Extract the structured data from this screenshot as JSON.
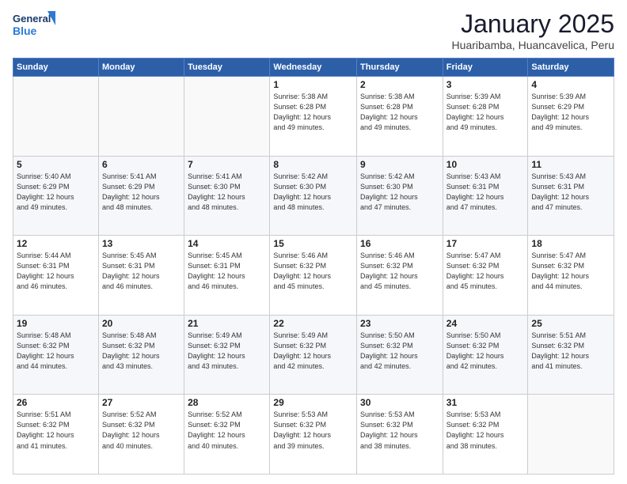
{
  "header": {
    "logo_line1": "General",
    "logo_line2": "Blue",
    "month_title": "January 2025",
    "location": "Huaribamba, Huancavelica, Peru"
  },
  "weekdays": [
    "Sunday",
    "Monday",
    "Tuesday",
    "Wednesday",
    "Thursday",
    "Friday",
    "Saturday"
  ],
  "weeks": [
    [
      {
        "day": "",
        "info": ""
      },
      {
        "day": "",
        "info": ""
      },
      {
        "day": "",
        "info": ""
      },
      {
        "day": "1",
        "info": "Sunrise: 5:38 AM\nSunset: 6:28 PM\nDaylight: 12 hours\nand 49 minutes."
      },
      {
        "day": "2",
        "info": "Sunrise: 5:38 AM\nSunset: 6:28 PM\nDaylight: 12 hours\nand 49 minutes."
      },
      {
        "day": "3",
        "info": "Sunrise: 5:39 AM\nSunset: 6:28 PM\nDaylight: 12 hours\nand 49 minutes."
      },
      {
        "day": "4",
        "info": "Sunrise: 5:39 AM\nSunset: 6:29 PM\nDaylight: 12 hours\nand 49 minutes."
      }
    ],
    [
      {
        "day": "5",
        "info": "Sunrise: 5:40 AM\nSunset: 6:29 PM\nDaylight: 12 hours\nand 49 minutes."
      },
      {
        "day": "6",
        "info": "Sunrise: 5:41 AM\nSunset: 6:29 PM\nDaylight: 12 hours\nand 48 minutes."
      },
      {
        "day": "7",
        "info": "Sunrise: 5:41 AM\nSunset: 6:30 PM\nDaylight: 12 hours\nand 48 minutes."
      },
      {
        "day": "8",
        "info": "Sunrise: 5:42 AM\nSunset: 6:30 PM\nDaylight: 12 hours\nand 48 minutes."
      },
      {
        "day": "9",
        "info": "Sunrise: 5:42 AM\nSunset: 6:30 PM\nDaylight: 12 hours\nand 47 minutes."
      },
      {
        "day": "10",
        "info": "Sunrise: 5:43 AM\nSunset: 6:31 PM\nDaylight: 12 hours\nand 47 minutes."
      },
      {
        "day": "11",
        "info": "Sunrise: 5:43 AM\nSunset: 6:31 PM\nDaylight: 12 hours\nand 47 minutes."
      }
    ],
    [
      {
        "day": "12",
        "info": "Sunrise: 5:44 AM\nSunset: 6:31 PM\nDaylight: 12 hours\nand 46 minutes."
      },
      {
        "day": "13",
        "info": "Sunrise: 5:45 AM\nSunset: 6:31 PM\nDaylight: 12 hours\nand 46 minutes."
      },
      {
        "day": "14",
        "info": "Sunrise: 5:45 AM\nSunset: 6:31 PM\nDaylight: 12 hours\nand 46 minutes."
      },
      {
        "day": "15",
        "info": "Sunrise: 5:46 AM\nSunset: 6:32 PM\nDaylight: 12 hours\nand 45 minutes."
      },
      {
        "day": "16",
        "info": "Sunrise: 5:46 AM\nSunset: 6:32 PM\nDaylight: 12 hours\nand 45 minutes."
      },
      {
        "day": "17",
        "info": "Sunrise: 5:47 AM\nSunset: 6:32 PM\nDaylight: 12 hours\nand 45 minutes."
      },
      {
        "day": "18",
        "info": "Sunrise: 5:47 AM\nSunset: 6:32 PM\nDaylight: 12 hours\nand 44 minutes."
      }
    ],
    [
      {
        "day": "19",
        "info": "Sunrise: 5:48 AM\nSunset: 6:32 PM\nDaylight: 12 hours\nand 44 minutes."
      },
      {
        "day": "20",
        "info": "Sunrise: 5:48 AM\nSunset: 6:32 PM\nDaylight: 12 hours\nand 43 minutes."
      },
      {
        "day": "21",
        "info": "Sunrise: 5:49 AM\nSunset: 6:32 PM\nDaylight: 12 hours\nand 43 minutes."
      },
      {
        "day": "22",
        "info": "Sunrise: 5:49 AM\nSunset: 6:32 PM\nDaylight: 12 hours\nand 42 minutes."
      },
      {
        "day": "23",
        "info": "Sunrise: 5:50 AM\nSunset: 6:32 PM\nDaylight: 12 hours\nand 42 minutes."
      },
      {
        "day": "24",
        "info": "Sunrise: 5:50 AM\nSunset: 6:32 PM\nDaylight: 12 hours\nand 42 minutes."
      },
      {
        "day": "25",
        "info": "Sunrise: 5:51 AM\nSunset: 6:32 PM\nDaylight: 12 hours\nand 41 minutes."
      }
    ],
    [
      {
        "day": "26",
        "info": "Sunrise: 5:51 AM\nSunset: 6:32 PM\nDaylight: 12 hours\nand 41 minutes."
      },
      {
        "day": "27",
        "info": "Sunrise: 5:52 AM\nSunset: 6:32 PM\nDaylight: 12 hours\nand 40 minutes."
      },
      {
        "day": "28",
        "info": "Sunrise: 5:52 AM\nSunset: 6:32 PM\nDaylight: 12 hours\nand 40 minutes."
      },
      {
        "day": "29",
        "info": "Sunrise: 5:53 AM\nSunset: 6:32 PM\nDaylight: 12 hours\nand 39 minutes."
      },
      {
        "day": "30",
        "info": "Sunrise: 5:53 AM\nSunset: 6:32 PM\nDaylight: 12 hours\nand 38 minutes."
      },
      {
        "day": "31",
        "info": "Sunrise: 5:53 AM\nSunset: 6:32 PM\nDaylight: 12 hours\nand 38 minutes."
      },
      {
        "day": "",
        "info": ""
      }
    ]
  ]
}
